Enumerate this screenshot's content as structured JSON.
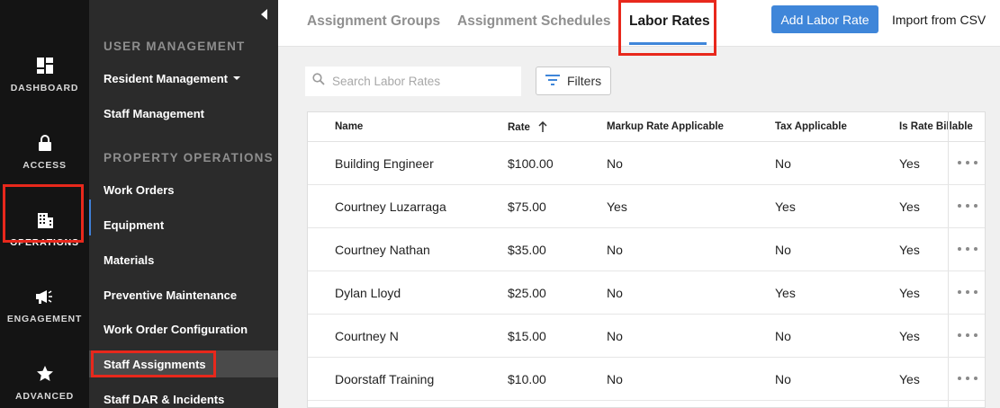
{
  "rail": {
    "items": [
      {
        "label": "DASHBOARD",
        "icon": "dashboard-icon"
      },
      {
        "label": "ACCESS",
        "icon": "lock-icon"
      },
      {
        "label": "OPERATIONS",
        "icon": "building-icon"
      },
      {
        "label": "ENGAGEMENT",
        "icon": "megaphone-icon"
      },
      {
        "label": "ADVANCED",
        "icon": "star-icon"
      }
    ]
  },
  "subnav": {
    "section1": "USER MANAGEMENT",
    "section2": "PROPERTY OPERATIONS",
    "items": [
      "Resident Management",
      "Staff Management",
      "Work Orders",
      "Equipment",
      "Materials",
      "Preventive Maintenance",
      "Work Order Configuration",
      "Staff Assignments",
      "Staff DAR & Incidents"
    ]
  },
  "tabs": [
    "Assignment Groups",
    "Assignment Schedules",
    "Labor Rates"
  ],
  "actions": {
    "add": "Add Labor Rate",
    "import": "Import from CSV"
  },
  "search": {
    "placeholder": "Search Labor Rates"
  },
  "filters": {
    "label": "Filters"
  },
  "table": {
    "headers": [
      "Name",
      "Rate",
      "Markup Rate Applicable",
      "Tax Applicable",
      "Is Rate Billable"
    ],
    "rows": [
      [
        "Building Engineer",
        "$100.00",
        "No",
        "No",
        "Yes"
      ],
      [
        "Courtney Luzarraga",
        "$75.00",
        "Yes",
        "Yes",
        "Yes"
      ],
      [
        "Courtney Nathan",
        "$35.00",
        "No",
        "No",
        "Yes"
      ],
      [
        "Dylan Lloyd",
        "$25.00",
        "No",
        "Yes",
        "Yes"
      ],
      [
        "Courtney N",
        "$15.00",
        "No",
        "No",
        "Yes"
      ],
      [
        "Doorstaff Training",
        "$10.00",
        "No",
        "No",
        "Yes"
      ]
    ]
  },
  "colors": {
    "accent": "#3f86d9",
    "highlight": "#e8281c",
    "rail": "#141414",
    "subnav": "#2b2b2b"
  }
}
